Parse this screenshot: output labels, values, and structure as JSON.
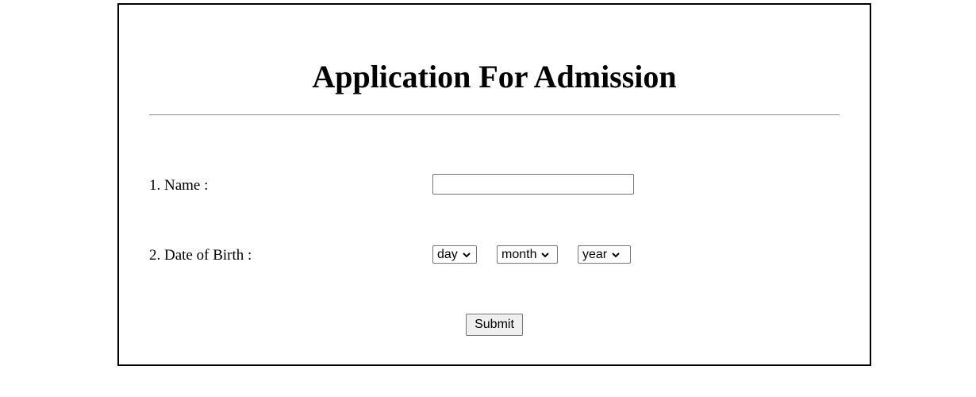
{
  "form": {
    "title": "Application For Admission",
    "name_label": "1. Name :",
    "name_value": "",
    "dob_label": "2. Date of Birth :",
    "dob": {
      "day_selected": "day",
      "month_selected": "month",
      "year_selected": "year"
    },
    "submit_label": "Submit"
  },
  "icons": {
    "select_arrow": "chevron-down-icon"
  },
  "colors": {
    "border": "#000000",
    "rule": "#9a9a9a",
    "button_bg": "#efefef",
    "control_border": "#767676"
  }
}
